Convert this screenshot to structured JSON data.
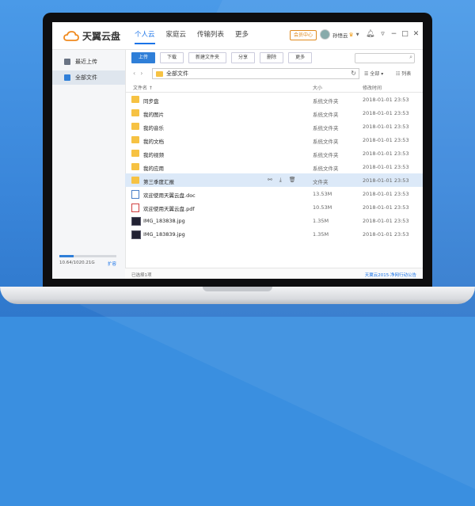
{
  "app": {
    "logo_text": "天翼云盘"
  },
  "nav": [
    "个人云",
    "家庭云",
    "传输列表",
    "更多"
  ],
  "header": {
    "member_center": "会员中心",
    "username": "孙悟云"
  },
  "sidebar": {
    "items": [
      {
        "label": "最近上传",
        "active": false
      },
      {
        "label": "全部文件",
        "active": true
      }
    ],
    "quota_text": "10.64/1020.21G",
    "quota_fraction": 0.0104,
    "expand_label": "扩容"
  },
  "toolbar": {
    "buttons": [
      "上传",
      "下载",
      "新建文件夹",
      "分享",
      "删除",
      "更多"
    ]
  },
  "pathbar": {
    "current_path": "全部文件",
    "filter_label": "全部",
    "view_label": "列表"
  },
  "columns": {
    "name": "文件名",
    "size": "大小",
    "date": "修改时间"
  },
  "files": [
    {
      "name": "同步盘",
      "size": "系统文件夹",
      "date": "2018-01-01 23:53",
      "type": "sync"
    },
    {
      "name": "我的图片",
      "size": "系统文件夹",
      "date": "2018-01-01 23:53",
      "type": "folder"
    },
    {
      "name": "我的音乐",
      "size": "系统文件夹",
      "date": "2018-01-01 23:53",
      "type": "folder"
    },
    {
      "name": "我的文档",
      "size": "系统文件夹",
      "date": "2018-01-01 23:53",
      "type": "folder"
    },
    {
      "name": "我的视频",
      "size": "系统文件夹",
      "date": "2018-01-01 23:53",
      "type": "folder"
    },
    {
      "name": "我的应用",
      "size": "系统文件夹",
      "date": "2018-01-01 23:53",
      "type": "folder"
    },
    {
      "name": "第三季度汇报",
      "size": "文件夹",
      "date": "2018-01-01 23:53",
      "type": "folder",
      "selected": true
    },
    {
      "name": "欢迎使用天翼云盘.doc",
      "size": "13.53M",
      "date": "2018-01-01 23:53",
      "type": "doc"
    },
    {
      "name": "欢迎使用天翼云盘.pdf",
      "size": "10.53M",
      "date": "2018-01-01 23:53",
      "type": "pdf"
    },
    {
      "name": "IMG_183838.jpg",
      "size": "1.35M",
      "date": "2018-01-01 23:53",
      "type": "img"
    },
    {
      "name": "IMG_183839.jpg",
      "size": "1.35M",
      "date": "2018-01-01 23:53",
      "type": "img"
    }
  ],
  "status": {
    "left": "已选择1项",
    "right": "天翼云2015·净网行动公告"
  },
  "colors": {
    "accent": "#2f7fd8",
    "folder": "#f6c243",
    "background": "#3a8fe0"
  }
}
